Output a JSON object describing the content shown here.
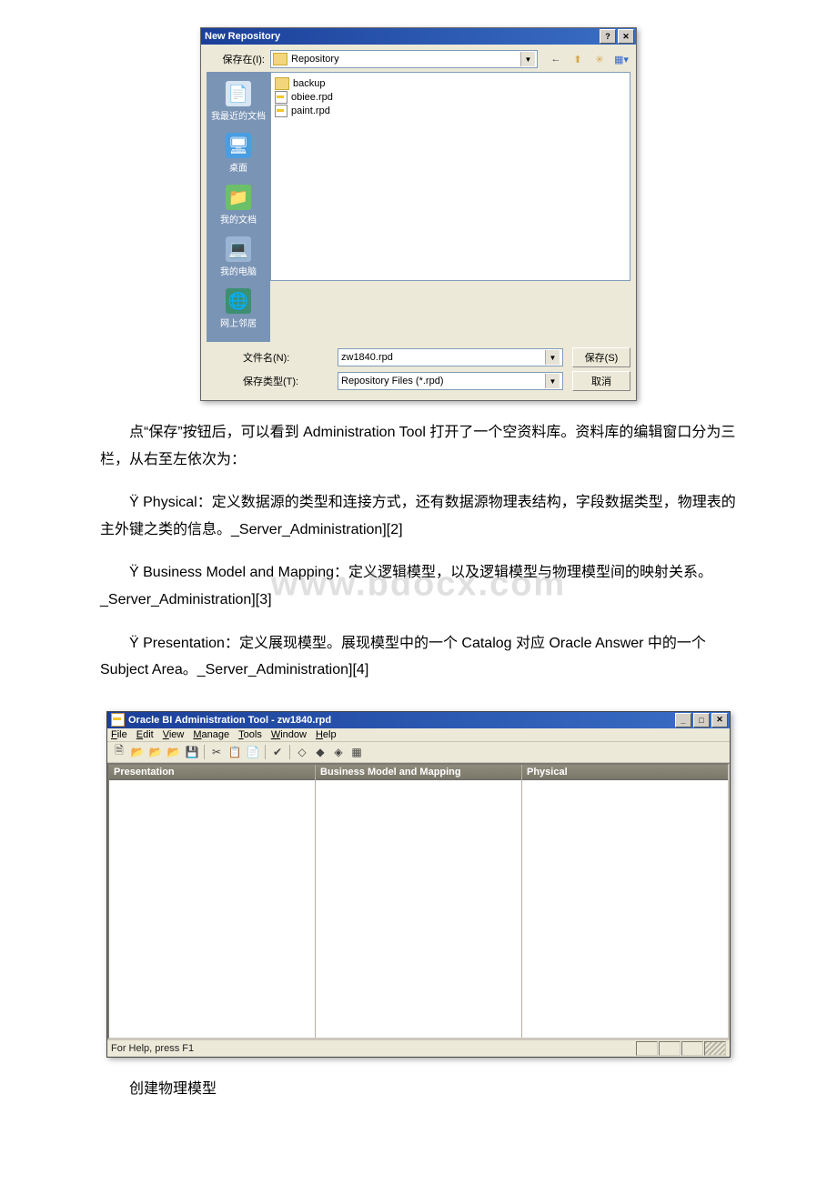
{
  "dialog": {
    "title": "New Repository",
    "saveIn": {
      "label": "保存在(I):",
      "value": "Repository"
    },
    "nav": {
      "back": "←",
      "up": "⬆",
      "newFolder": "✳",
      "views": "▦▾"
    },
    "places": [
      {
        "label": "我最近的文档"
      },
      {
        "label": "桌面"
      },
      {
        "label": "我的文档"
      },
      {
        "label": "我的电脑"
      },
      {
        "label": "网上邻居"
      }
    ],
    "files": [
      {
        "name": "backup",
        "type": "folder"
      },
      {
        "name": "obiee.rpd",
        "type": "rpd"
      },
      {
        "name": "paint.rpd",
        "type": "rpd"
      }
    ],
    "fileNameLabel": "文件名(N):",
    "fileName": "zw1840.rpd",
    "saveTypeLabel": "保存类型(T):",
    "saveType": "Repository Files (*.rpd)",
    "saveBtn": "保存(S)",
    "cancelBtn": "取消"
  },
  "text": {
    "p1": "点“保存”按钮后，可以看到 Administration Tool 打开了一个空资料库。资料库的编辑窗口分为三栏，从右至左依次为：",
    "p2": "Ÿ Physical：定义数据源的类型和连接方式，还有数据源物理表结构，字段数据类型，物理表的主外键之类的信息。_Server_Administration][2]",
    "p3": "Ÿ Business Model and Mapping：定义逻辑模型，以及逻辑模型与物理模型间的映射关系。_Server_Administration][3]",
    "p4": "Ÿ Presentation：定义展现模型。展现模型中的一个 Catalog 对应 Oracle Answer 中的一个 Subject Area。_Server_Administration][4]",
    "p5": "创建物理模型",
    "watermark": "www.bdocx.com"
  },
  "admin": {
    "title": "Oracle BI Administration Tool - zw1840.rpd",
    "menus": [
      "File",
      "Edit",
      "View",
      "Manage",
      "Tools",
      "Window",
      "Help"
    ],
    "paneTitles": [
      "Presentation",
      "Business Model and Mapping",
      "Physical"
    ],
    "status": "For Help, press F1"
  }
}
